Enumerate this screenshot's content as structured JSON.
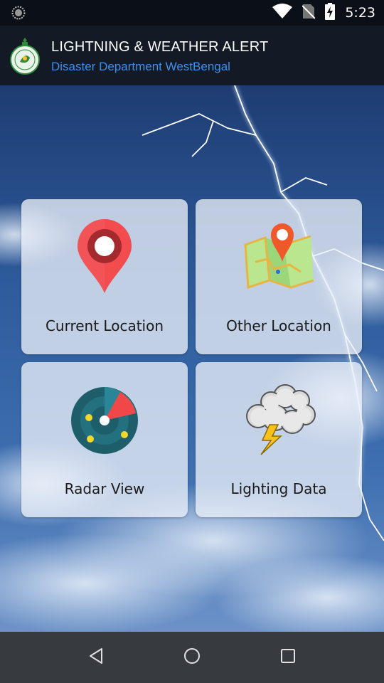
{
  "status_bar": {
    "time": "5:23",
    "icons": [
      "sync-icon",
      "wifi-icon",
      "no-sim-icon",
      "battery-charging-icon"
    ]
  },
  "app_bar": {
    "title": "LIGHTNING & WEATHER ALERT",
    "subtitle": "Disaster Department WestBengal",
    "logo": "west-bengal-emblem",
    "subtitle_color": "#3b8ff0"
  },
  "tiles": [
    {
      "label": "Current Location",
      "icon": "map-pin-icon"
    },
    {
      "label": "Other Location",
      "icon": "map-location-icon"
    },
    {
      "label": "Radar View",
      "icon": "radar-icon"
    },
    {
      "label": "Lighting Data",
      "icon": "storm-cloud-icon"
    }
  ],
  "nav_bar": {
    "buttons": [
      "back-icon",
      "home-icon",
      "recents-icon"
    ]
  }
}
